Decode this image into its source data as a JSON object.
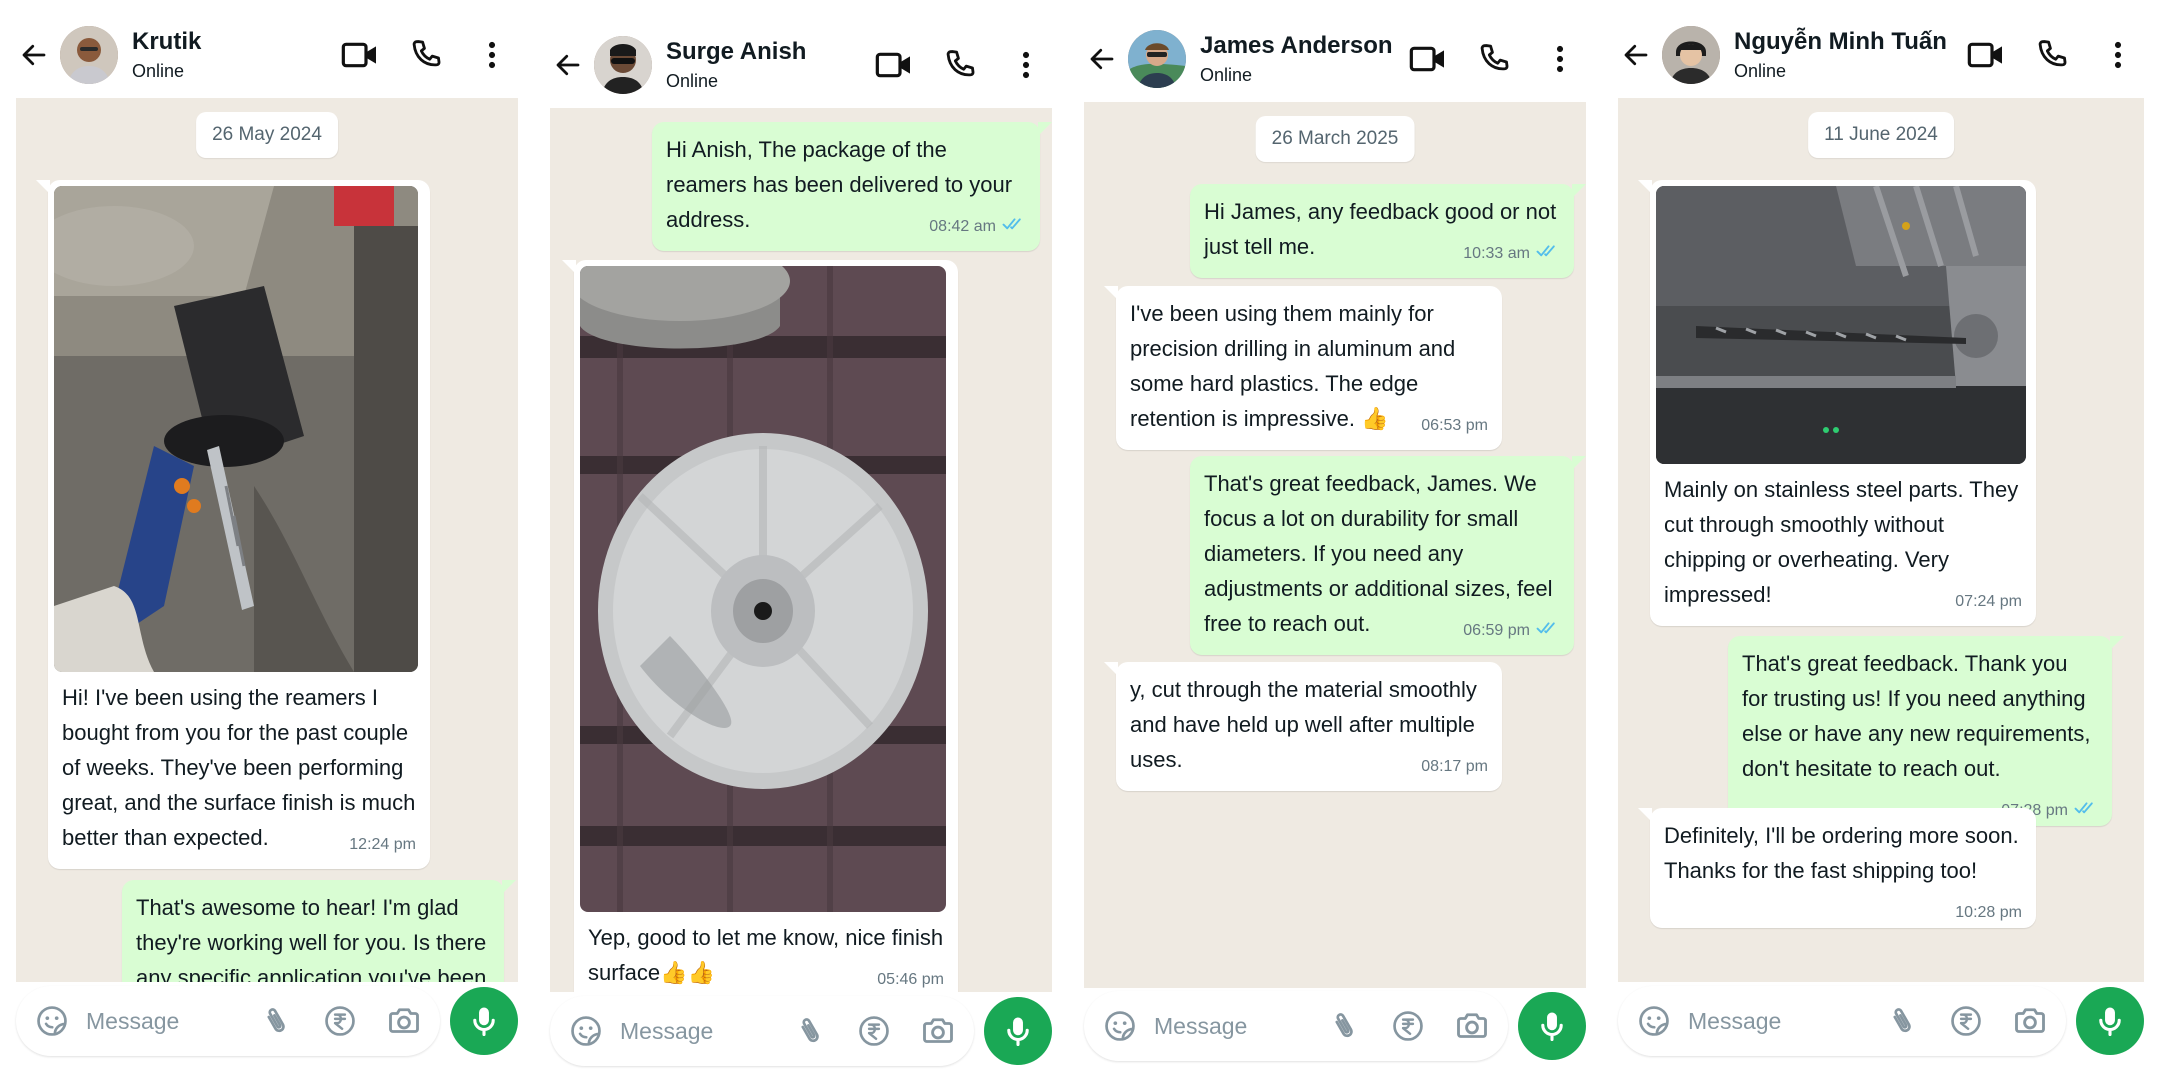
{
  "colors": {
    "outgoing": "#d9fdd3",
    "incoming": "#ffffff",
    "chat_bg": "#efeae2",
    "accent": "#1aa855",
    "read_ticks": "#53bdeb"
  },
  "icons": [
    "back-arrow-icon",
    "video-call-icon",
    "voice-call-icon",
    "more-options-icon",
    "sticker-icon",
    "attach-icon",
    "rupee-payment-icon",
    "camera-icon",
    "mic-icon",
    "double-check-icon"
  ],
  "composer": {
    "placeholder": "Message"
  },
  "chats": [
    {
      "contact": {
        "name": "Krutik",
        "status": "Online"
      },
      "date": "26 May 2024",
      "messages": [
        {
          "type": "image",
          "direction": "in",
          "image_desc": "reamer-in-lathe-chuck",
          "text": "Hi! I've been using the reamers I bought from you for the past couple of weeks. They've been performing great, and the surface finish is much better than expected.",
          "time": "12:24 pm"
        },
        {
          "type": "text",
          "direction": "out",
          "text": "That's awesome to hear! I'm glad they're working well for you. Is there any specific application you've been",
          "time": ""
        }
      ]
    },
    {
      "contact": {
        "name": "Surge Anish",
        "status": "Online"
      },
      "date": "",
      "messages": [
        {
          "type": "text",
          "direction": "out",
          "text": "Hi Anish, The package of the reamers has been delivered to your address.",
          "time": "08:42 am"
        },
        {
          "type": "image",
          "direction": "in",
          "image_desc": "machined-aluminum-disc",
          "text": "Yep, good to let me know, nice finish surface👍👍",
          "time": "05:46 pm"
        }
      ]
    },
    {
      "contact": {
        "name": "James Anderson",
        "status": "Online"
      },
      "date": "26 March 2025",
      "messages": [
        {
          "type": "text",
          "direction": "out",
          "text": "Hi James, any feedback good or not just tell me.",
          "time": "10:33 am"
        },
        {
          "type": "text",
          "direction": "in",
          "text": "I've been using them mainly for precision drilling in aluminum and some hard plastics. The edge retention is impressive. 👍",
          "time": "06:53 pm"
        },
        {
          "type": "text",
          "direction": "out",
          "text": "That's great feedback, James. We focus a lot on durability for small diameters. If you need any adjustments or additional sizes, feel free to reach out.",
          "time": "06:59 pm"
        },
        {
          "type": "text",
          "direction": "in",
          "text": "y, cut through the material smoothly and have held up well after multiple uses.",
          "time": "08:17 pm"
        }
      ]
    },
    {
      "contact": {
        "name": "Nguyễn Minh Tuấn",
        "status": "Online"
      },
      "date": "11 June 2024",
      "messages": [
        {
          "type": "image",
          "direction": "in",
          "image_desc": "drill-bit-in-cnc-machine",
          "text": "Mainly on stainless steel parts. They cut through smoothly without chipping or overheating. Very impressed!",
          "time": "07:24 pm"
        },
        {
          "type": "text",
          "direction": "out",
          "text": "That's great feedback. Thank you for trusting us! If you need anything else or have any new requirements, don't hesitate to reach out.",
          "time": "07:28 pm"
        },
        {
          "type": "text",
          "direction": "in",
          "text": "Definitely, I'll be ordering more soon. Thanks for the fast shipping too!",
          "time": "10:28 pm"
        }
      ]
    }
  ]
}
